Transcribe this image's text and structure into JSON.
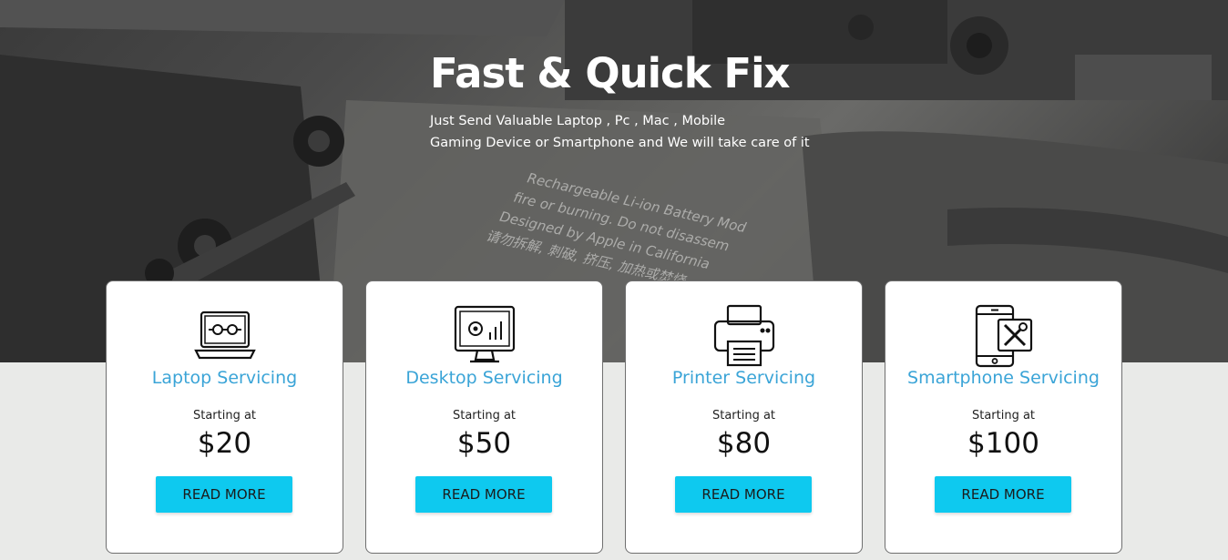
{
  "hero": {
    "title": "Fast & Quick Fix",
    "subtitle_line1": "Just Send Valuable Laptop , Pc , Mac , Mobile",
    "subtitle_line2": "Gaming Device or Smartphone and We will take care of it",
    "background_text": [
      "Rechargeable Li-ion Battery Mod",
      "fire or burning. Do not disassem",
      "Designed by Apple in California",
      "请勿拆解, 刺破, 挤压, 加热或焚烧"
    ]
  },
  "colors": {
    "accent": "#0ec9ef",
    "title_blue": "#3aa4d7",
    "page_bg": "#e9eae8"
  },
  "cards": [
    {
      "icon": "laptop-gear-icon",
      "title": "Laptop Servicing",
      "starting": "Starting at",
      "price": "$20",
      "button": "READ MORE"
    },
    {
      "icon": "desktop-monitor-icon",
      "title": "Desktop Servicing",
      "starting": "Starting at",
      "price": "$50",
      "button": "READ MORE"
    },
    {
      "icon": "printer-icon",
      "title": "Printer Servicing",
      "starting": "Starting at",
      "price": "$80",
      "button": "READ MORE"
    },
    {
      "icon": "smartphone-tools-icon",
      "title": "Smartphone Servicing",
      "starting": "Starting at",
      "price": "$100",
      "button": "READ MORE"
    }
  ]
}
